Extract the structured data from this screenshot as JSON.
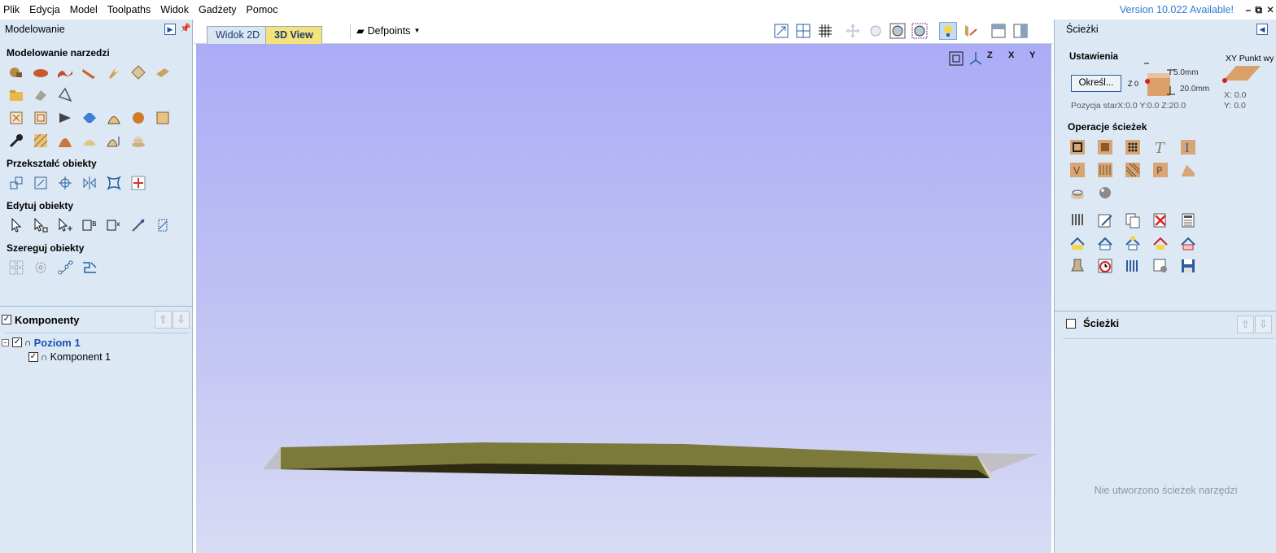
{
  "menu": [
    "Plik",
    "Edycja",
    "Model",
    "Toolpaths",
    "Widok",
    "Gadżety",
    "Pomoc"
  ],
  "version_text": "Version 10.022 Available!",
  "left_panel": {
    "title": "Modelowanie",
    "sections": {
      "modeling_tools": "Modelowanie narzedzi",
      "transform": "Przekształć obiekty",
      "edit": "Edytuj obiekty",
      "arrange": "Szereguj obiekty"
    },
    "components": {
      "header": "Komponenty",
      "level": "Poziom 1",
      "component": "Komponent 1"
    }
  },
  "center": {
    "tabs": [
      "Widok 2D",
      "3D View"
    ],
    "active_tab": "3D View",
    "layer_dropdown": "Defpoints",
    "axis_labels": [
      "Z",
      "X",
      "Y"
    ]
  },
  "right_panel": {
    "title": "Ścieżki",
    "settings": {
      "header": "Ustawienia",
      "button": "Określ...",
      "dim_top": "5.0mm",
      "dim_bottom": "20.0mm",
      "z_label": "Z 0",
      "xy_title": "XY Punkt wy",
      "x_val": "X: 0.0",
      "y_val": "Y: 0.0",
      "start_pos": "Pozycja starX:0.0 Y:0.0 Z:20.0"
    },
    "ops_header": "Operacje ścieżek",
    "paths_header": "Ścieżki",
    "empty_text": "Nie utworzono ścieżek narzędzi"
  },
  "colors": {
    "panel_bg": "#dce9f5",
    "viewport_top": "#abacf6",
    "model": "#7c7a3a",
    "accent": "#2d7bd1"
  }
}
